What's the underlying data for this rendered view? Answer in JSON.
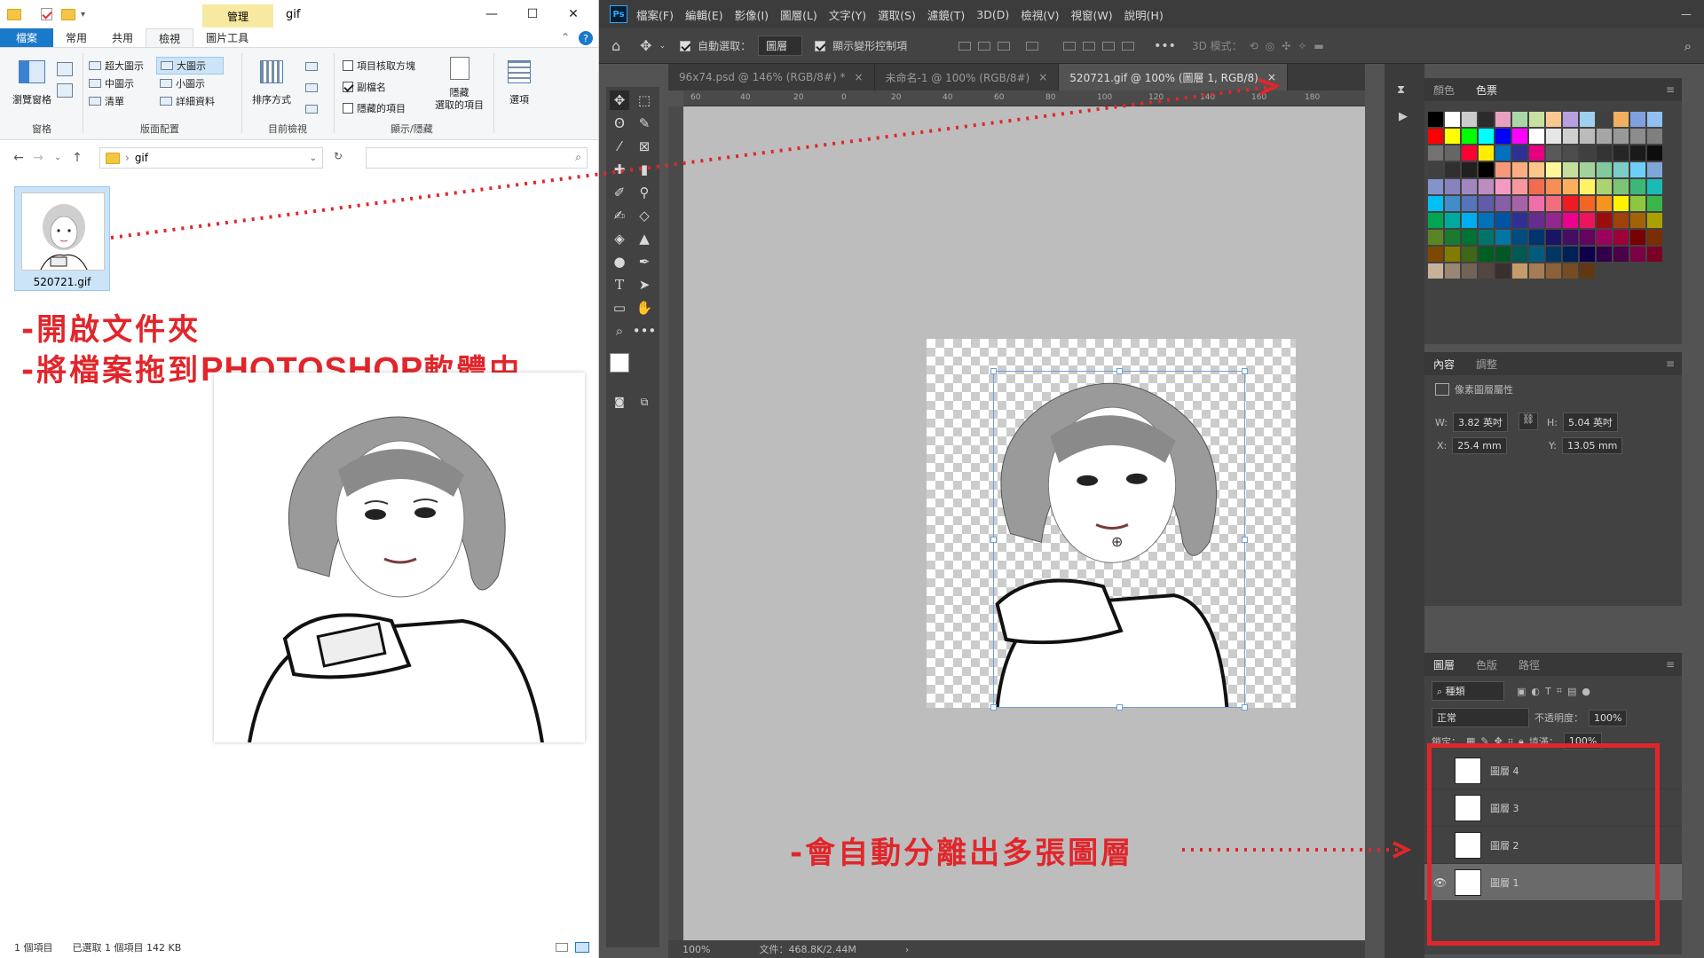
{
  "explorer": {
    "window_title": "gif",
    "manage_tab": "管理",
    "tabs": [
      "檔案",
      "常用",
      "共用",
      "檢視",
      "圖片工具"
    ],
    "ribbon": {
      "nav_pane": "瀏覽窗格",
      "layout_items": [
        "超大圖示",
        "大圖示",
        "中圖示",
        "小圖示",
        "清單",
        "詳細資料"
      ],
      "sort_by": "排序方式",
      "show_checkbox_items": [
        "項目核取方塊",
        "副檔名",
        "隱藏的項目"
      ],
      "hide_selected": "隱藏\n選取的項目",
      "options": "選項",
      "group_labels": [
        "窗格",
        "版面配置",
        "目前檢視",
        "顯示/隱藏"
      ]
    },
    "address": "gif",
    "file": {
      "name": "520721.gif"
    },
    "status": {
      "items": "1 個項目",
      "selected": "已選取 1 個項目  142 KB"
    }
  },
  "annotations": {
    "line1": "-開啟文件夾",
    "line2_prefix": "-將檔案拖到",
    "line2_bold": "PHOTOSHOP",
    "line2_suffix": "軟體中",
    "layers_note": "-會自動分離出多張圖層"
  },
  "photoshop": {
    "menu": [
      "檔案(F)",
      "編輯(E)",
      "影像(I)",
      "圖層(L)",
      "文字(Y)",
      "選取(S)",
      "濾鏡(T)",
      "3D(D)",
      "檢視(V)",
      "視窗(W)",
      "說明(H)"
    ],
    "options": {
      "auto_select": "自動選取：",
      "auto_select_target": "圖層",
      "show_transform": "顯示變形控制項",
      "mode_3d": "3D 模式："
    },
    "tabs": [
      {
        "label": "96x74.psd @ 146% (RGB/8#) *"
      },
      {
        "label": "未命名-1 @ 100% (RGB/8#)"
      },
      {
        "label": "520721.gif @ 100% (圖層 1, RGB/8)"
      }
    ],
    "ruler_ticks": [
      "60",
      "40",
      "20",
      "0",
      "20",
      "40",
      "60",
      "80",
      "100",
      "120",
      "140",
      "160",
      "180"
    ],
    "status": {
      "zoom": "100%",
      "doc": "文件：468.8K/2.44M"
    },
    "color_panel_tabs": [
      "顏色",
      "色票"
    ],
    "properties": {
      "tabs": [
        "內容",
        "調整"
      ],
      "title": "像素圖層屬性",
      "w": "3.82 英吋",
      "h": "5.04 英吋",
      "x": "25.4 mm",
      "y": "13.05 mm"
    },
    "layers_panel": {
      "tabs": [
        "圖層",
        "色版",
        "路徑"
      ],
      "filter": "種類",
      "blend": "正常",
      "opacity_label": "不透明度：",
      "opacity": "100%",
      "lock_label": "鎖定：",
      "fill_label": "填滿：",
      "fill": "100%",
      "layers": [
        "圖層 4",
        "圖層 3",
        "圖層 2",
        "圖層 1"
      ],
      "selected_layer": "圖層 1"
    }
  },
  "colors": {
    "accent_red": "#e1262b",
    "ps_bg": "#535353",
    "explorer_accent": "#1979ca"
  }
}
